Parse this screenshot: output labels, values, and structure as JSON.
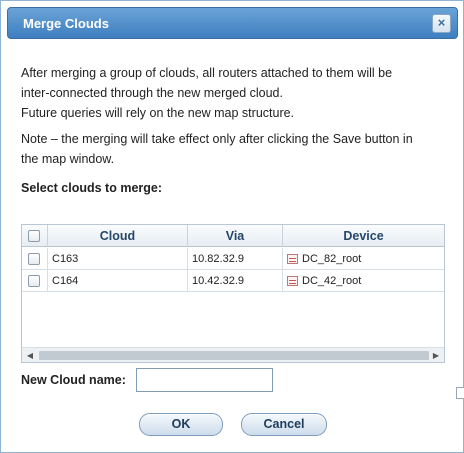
{
  "dialog": {
    "title": "Merge Clouds",
    "close_glyph": "×"
  },
  "description": {
    "line1": "After merging a group of clouds, all routers attached to them will be",
    "line2": "inter-connected through the new merged cloud.",
    "line3": "Future queries will rely on the new map structure.",
    "note1": "Note – the merging will take effect only after clicking the Save button in",
    "note2": "the map window."
  },
  "select_label": "Select clouds to merge:",
  "grid": {
    "columns": [
      "Cloud",
      "Via",
      "Device"
    ],
    "rows": [
      {
        "cloud": "C163",
        "via": "10.82.32.9",
        "device": "DC_82_root",
        "device_icon": "router-icon",
        "checked": false
      },
      {
        "cloud": "C164",
        "via": "10.42.32.9",
        "device": "DC_42_root",
        "device_icon": "router-icon",
        "checked": false
      }
    ],
    "scroll_left_glyph": "◀",
    "scroll_right_glyph": "▶"
  },
  "new_cloud": {
    "label": "New Cloud name:",
    "value": "",
    "placeholder": ""
  },
  "buttons": {
    "ok": "OK",
    "cancel": "Cancel"
  },
  "colors": {
    "title_bar": "#4f8ccb",
    "header_text": "#26476b"
  }
}
